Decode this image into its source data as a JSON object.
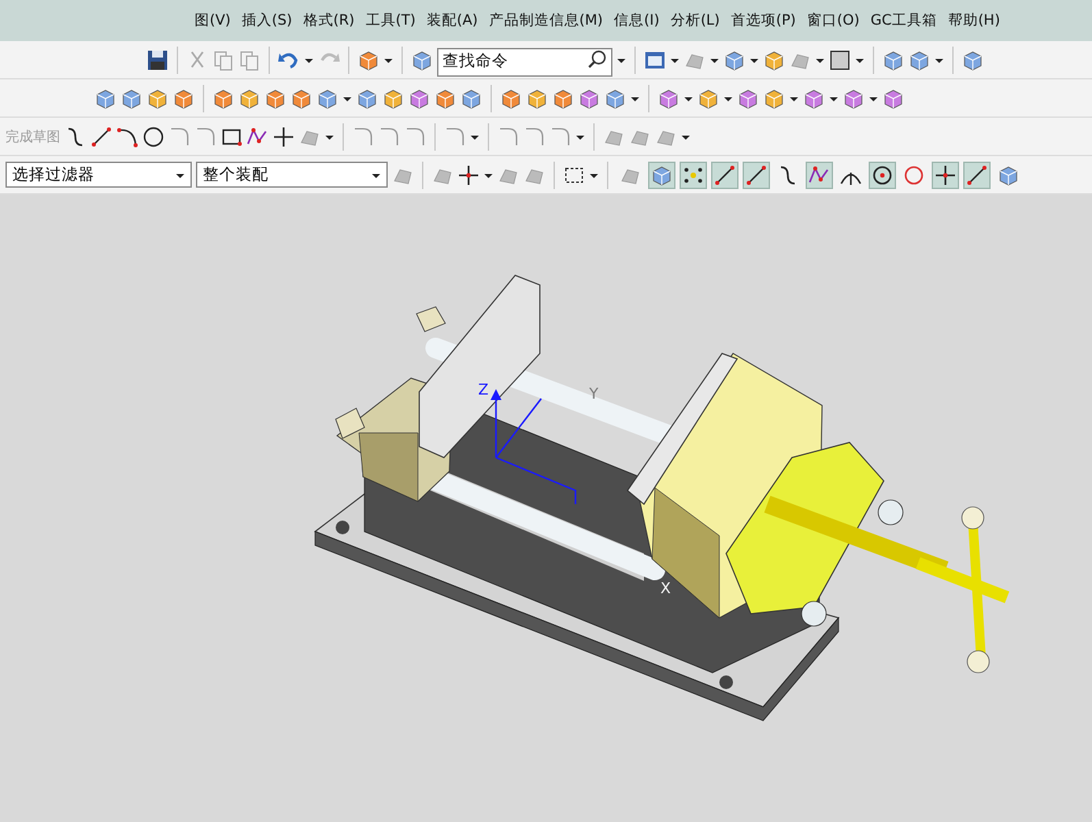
{
  "menu_bar": {
    "items": [
      "图(V)",
      "插入(S)",
      "格式(R)",
      "工具(T)",
      "装配(A)",
      "产品制造信息(M)",
      "信息(I)",
      "分析(L)",
      "首选项(P)",
      "窗口(O)",
      "GC工具箱",
      "帮助(H)"
    ]
  },
  "command_search": {
    "placeholder": "查找命令"
  },
  "sketch_toolbar": {
    "finish_label": "完成草图"
  },
  "selection_bar": {
    "filter": "选择过滤器",
    "scope": "整个装配"
  },
  "snap_buttons": [
    {
      "selected": false
    },
    {
      "selected": true
    },
    {
      "selected": true
    },
    {
      "selected": true
    },
    {
      "selected": true
    },
    {
      "selected": false
    },
    {
      "selected": true
    },
    {
      "selected": false
    },
    {
      "selected": true
    },
    {
      "selected": false
    },
    {
      "selected": true
    },
    {
      "selected": true
    },
    {
      "selected": false
    }
  ],
  "viewport": {
    "axis_labels": [
      "Z",
      "Y",
      "X"
    ]
  }
}
